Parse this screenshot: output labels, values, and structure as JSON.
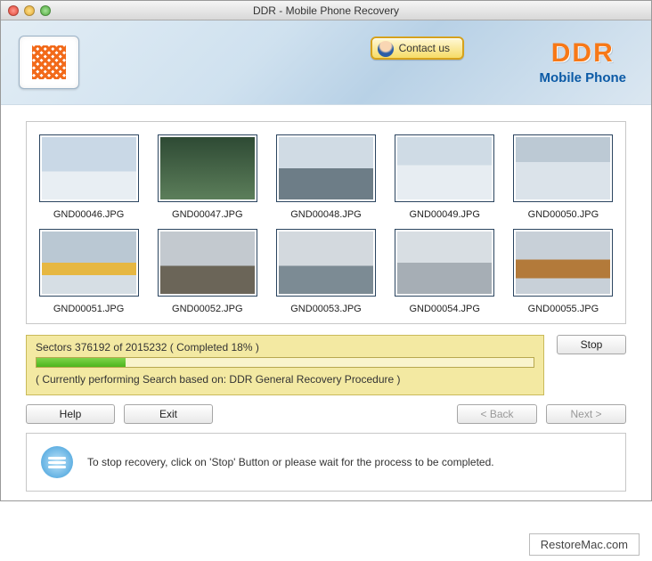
{
  "window": {
    "title": "DDR - Mobile Phone Recovery"
  },
  "banner": {
    "contact_label": "Contact us",
    "brand_title": "DDR",
    "brand_sub": "Mobile Phone"
  },
  "gallery": {
    "items": [
      {
        "filename": "GND00046.JPG"
      },
      {
        "filename": "GND00047.JPG"
      },
      {
        "filename": "GND00048.JPG"
      },
      {
        "filename": "GND00049.JPG"
      },
      {
        "filename": "GND00050.JPG"
      },
      {
        "filename": "GND00051.JPG"
      },
      {
        "filename": "GND00052.JPG"
      },
      {
        "filename": "GND00053.JPG"
      },
      {
        "filename": "GND00054.JPG"
      },
      {
        "filename": "GND00055.JPG"
      }
    ]
  },
  "progress": {
    "sectors_line": "Sectors 376192 of 2015232   ( Completed 18% )",
    "percent": 18,
    "status_line": "( Currently performing Search based on: DDR General Recovery Procedure )",
    "stop_label": "Stop"
  },
  "nav": {
    "help_label": "Help",
    "exit_label": "Exit",
    "back_label": "< Back",
    "next_label": "Next >"
  },
  "hint": {
    "text": "To stop recovery, click on 'Stop' Button or please wait for the process to be completed."
  },
  "footer": {
    "watermark": "RestoreMac.com"
  }
}
